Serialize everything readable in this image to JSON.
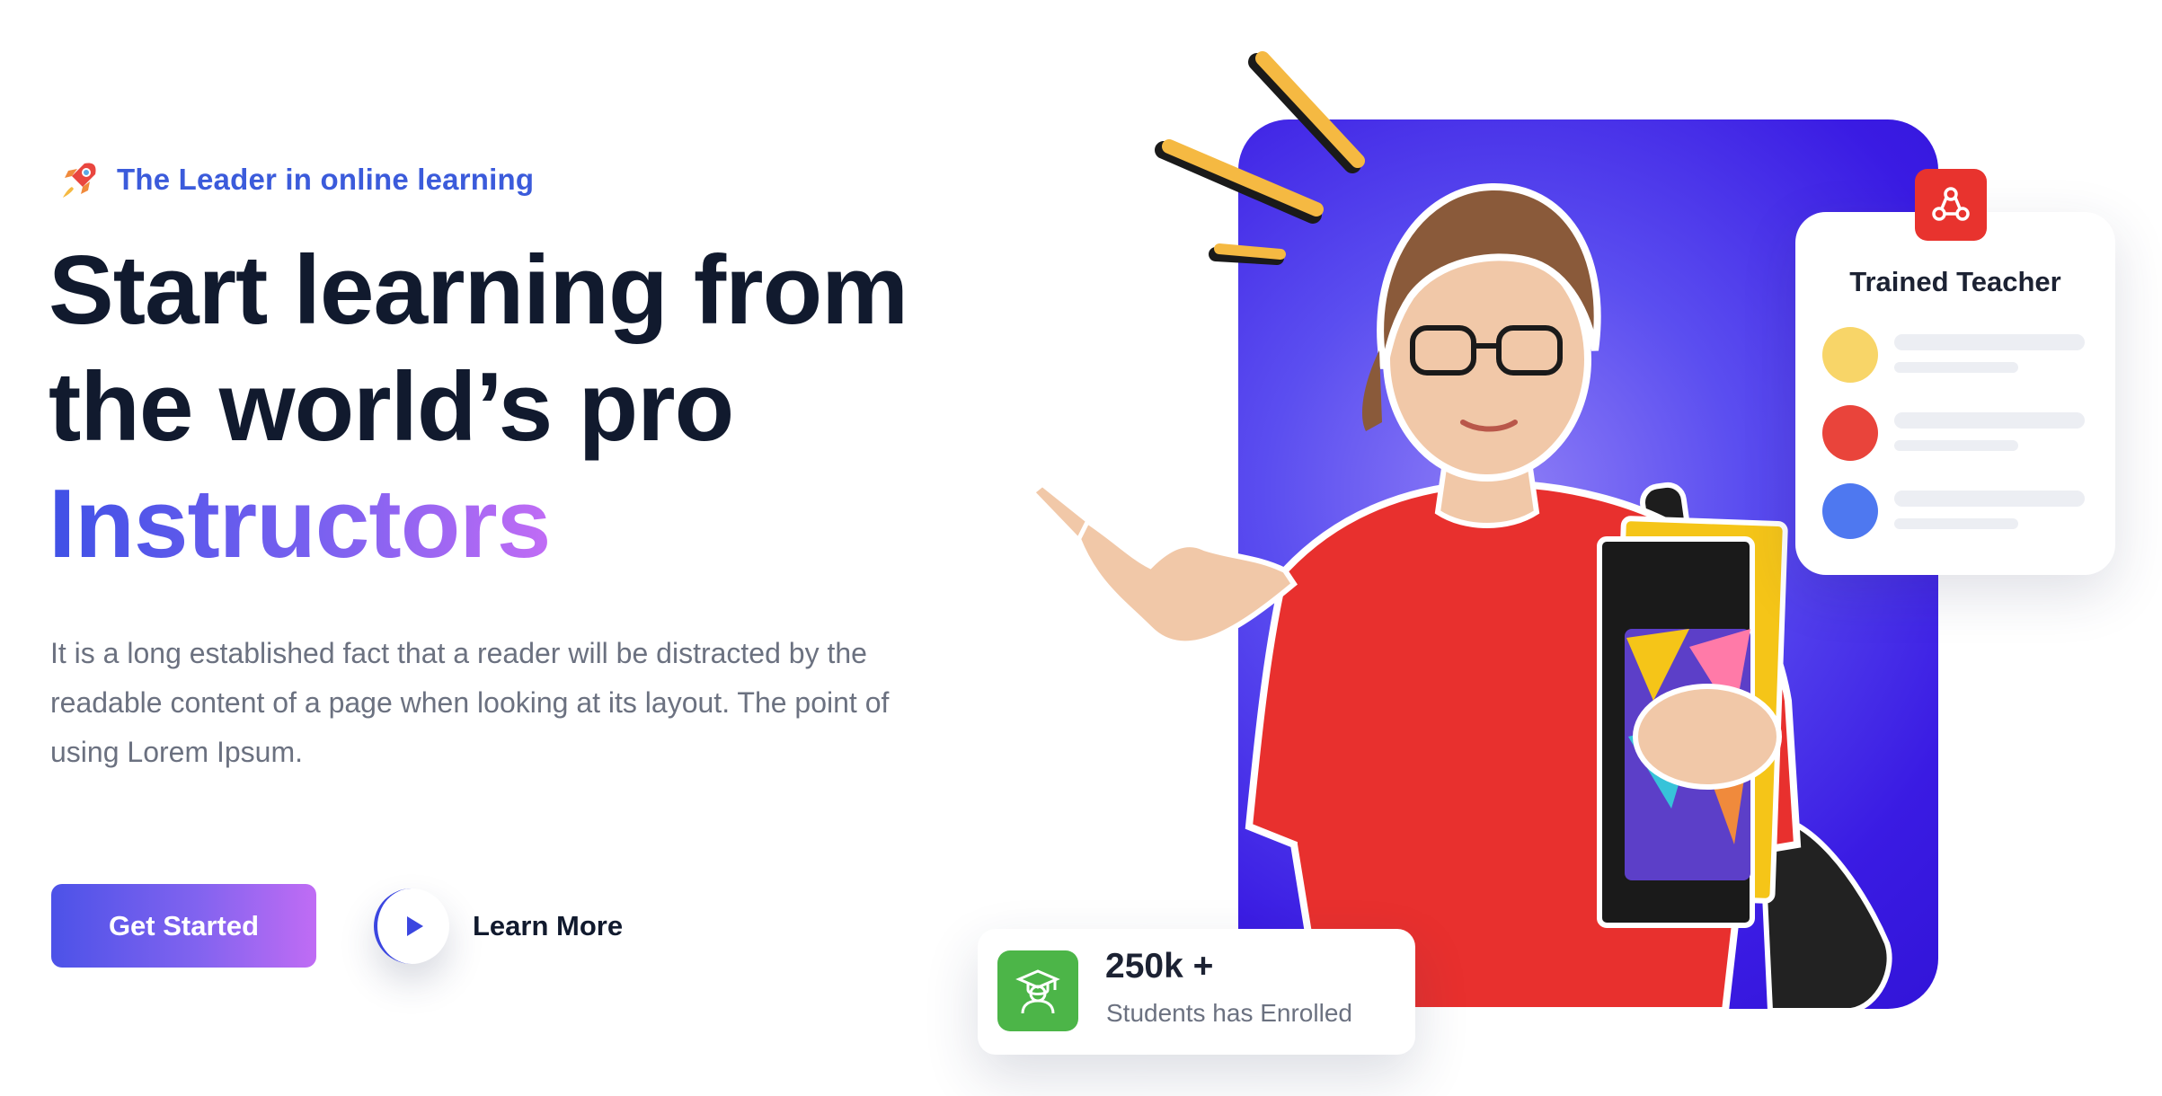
{
  "hero": {
    "tagline": "The Leader in online learning",
    "headline_line1": "Start learning from",
    "headline_line2": "the world’s pro",
    "headline_highlight": "Instructors",
    "description": "It is a long established fact that a reader will be distracted by the readable content of a page when looking at its layout. The point of using Lorem Ipsum.",
    "primary_cta": "Get Started",
    "secondary_cta": "Learn More"
  },
  "teacher_card": {
    "title": "Trained Teacher",
    "icon": "network-icon",
    "rows": [
      {
        "color": "#f8d568"
      },
      {
        "color": "#e9443b"
      },
      {
        "color": "#4e78f0"
      }
    ]
  },
  "students_card": {
    "count": "250k +",
    "label": "Students has Enrolled",
    "icon": "graduate-icon"
  },
  "colors": {
    "accent_blue": "#3b5bdb",
    "gradient_start": "#3f51e6",
    "gradient_end": "#c16cf5",
    "hero_bg": "#3a1be3",
    "teacher_icon_bg": "#e8332e",
    "students_icon_bg": "#4cb548",
    "spark": "#f5b942"
  },
  "icons": {
    "tagline": "rocket-icon",
    "play": "play-icon"
  }
}
